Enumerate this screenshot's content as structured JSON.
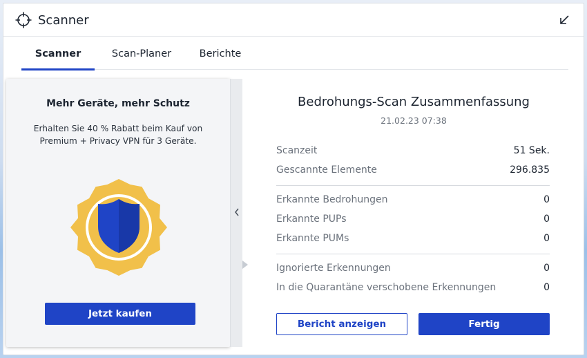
{
  "window": {
    "title": "Scanner",
    "title_icon": "crosshair-icon",
    "collapse_icon": "arrow-down-left-icon"
  },
  "tabs": [
    {
      "label": "Scanner",
      "active": true
    },
    {
      "label": "Scan-Planer",
      "active": false
    },
    {
      "label": "Berichte",
      "active": false
    }
  ],
  "promo": {
    "title": "Mehr Geräte, mehr Schutz",
    "description_line1": "Erhalten Sie 40 % Rabatt beim Kauf von",
    "description_line2": "Premium + Privacy VPN für 3 Geräte.",
    "badge_icon": "shield-badge-icon",
    "buy_label": "Jetzt kaufen",
    "collapse_icon": "chevron-left-icon"
  },
  "summary": {
    "title": "Bedrohungs-Scan Zusammenfassung",
    "date": "21.02.23 07:38",
    "group1": [
      {
        "label": "Scanzeit",
        "value": "51 Sek."
      },
      {
        "label": "Gescannte Elemente",
        "value": "296.835"
      }
    ],
    "group2": [
      {
        "label": "Erkannte Bedrohungen",
        "value": "0"
      },
      {
        "label": "Erkannte PUPs",
        "value": "0"
      },
      {
        "label": "Erkannte PUMs",
        "value": "0"
      }
    ],
    "group3": [
      {
        "label": "Ignorierte Erkennungen",
        "value": "0"
      },
      {
        "label": "In die Quarantäne verschobene Erkennungen",
        "value": "0"
      }
    ],
    "report_button": "Bericht anzeigen",
    "done_button": "Fertig"
  },
  "colors": {
    "accent": "#1f44c6",
    "badge_gold": "#f1c04a",
    "shield_blue": "#1f44c6"
  }
}
